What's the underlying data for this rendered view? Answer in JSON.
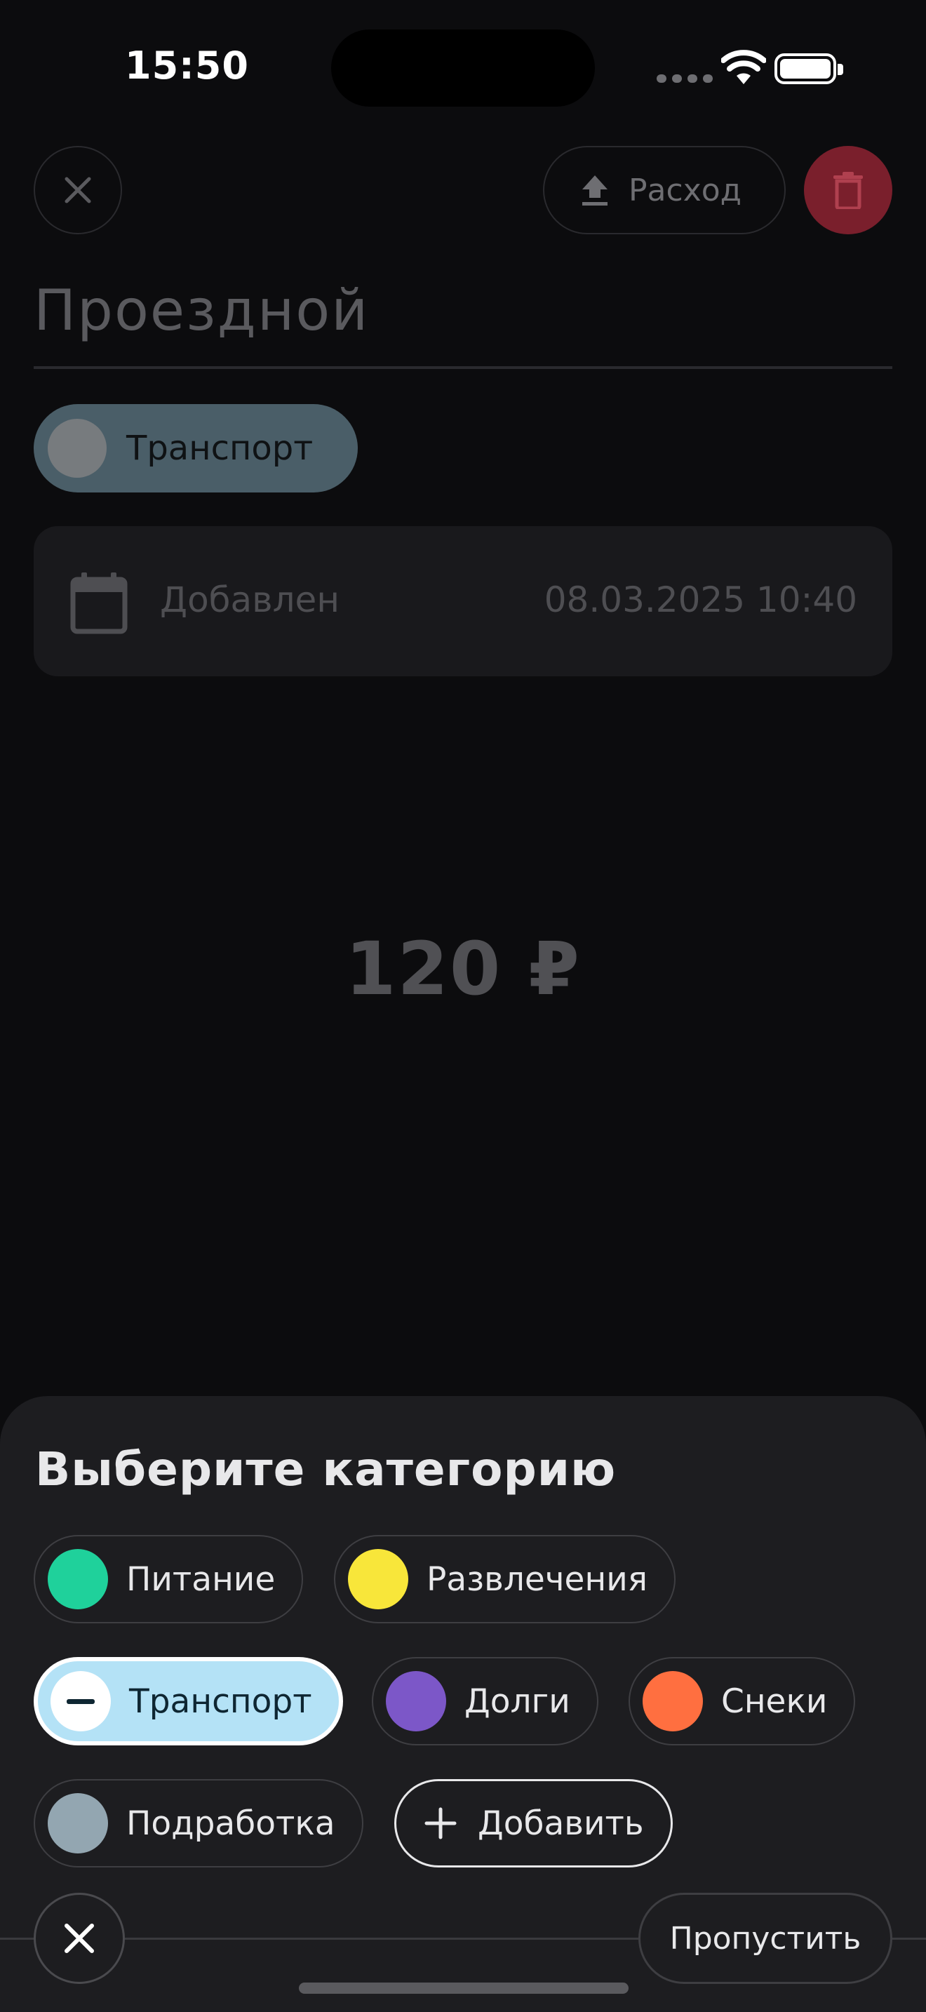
{
  "status_bar": {
    "time": "15:50"
  },
  "page": {
    "type_button_label": "Расход",
    "title_value": "Проездной",
    "current_category": "Транспорт",
    "date_label": "Добавлен",
    "date_value": "08.03.2025 10:40",
    "amount": "120 ₽",
    "delete_color": "#7a1f2c"
  },
  "sheet": {
    "title": "Выберите категорию",
    "categories": [
      {
        "label": "Питание",
        "color": "#1fd19b"
      },
      {
        "label": "Развлечения",
        "color": "#f8e63a"
      },
      {
        "label": "Транспорт",
        "color": "#b4e2f6",
        "selected": true
      },
      {
        "label": "Долги",
        "color": "#7c57c8"
      },
      {
        "label": "Снеки",
        "color": "#ff6f40"
      },
      {
        "label": "Подработка",
        "color": "#93a6b1"
      }
    ],
    "add_label": "Добавить",
    "skip_label": "Пропустить"
  },
  "icons": {
    "close": "close-icon",
    "upload": "upload-icon",
    "delete": "trash-icon",
    "calendar": "calendar-icon",
    "add": "plus-icon",
    "selected": "minus-icon"
  }
}
